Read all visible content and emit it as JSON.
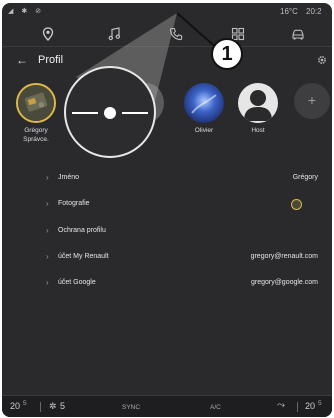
{
  "statusbar": {
    "left_icons": "◢ ✱ ⊘",
    "temperature": "16°C",
    "time": "20:2"
  },
  "nav": {
    "icons": [
      "location-pin-icon",
      "music-note-icon",
      "phone-icon",
      "apps-grid-icon",
      "car-icon"
    ]
  },
  "header": {
    "back_icon": "←",
    "title": "Profil"
  },
  "profiles": [
    {
      "name": "Grégory",
      "role": "Správce."
    },
    {
      "name": "Olivier"
    },
    {
      "name": "Host"
    }
  ],
  "add_profile_icon": "+",
  "settings": [
    {
      "label": "Jméno",
      "value": "Grégory"
    },
    {
      "label": "Fotografie",
      "value": ""
    },
    {
      "label": "Ochrana profilu",
      "value": ""
    },
    {
      "label": "účet My Renault",
      "value": "gregory@renault.com"
    },
    {
      "label": "účet Google",
      "value": "gregory@google.com"
    }
  ],
  "bottombar": {
    "left_temp": "20",
    "left_half": "5",
    "fan_level": "5",
    "sync": "SYNC",
    "ac": "A/C",
    "right_temp": "20",
    "right_half": "5"
  },
  "callout": {
    "number": "1"
  },
  "colors": {
    "background": "#2a2a2c",
    "text": "#e8e8e8",
    "divider": "#3b3b3e"
  }
}
